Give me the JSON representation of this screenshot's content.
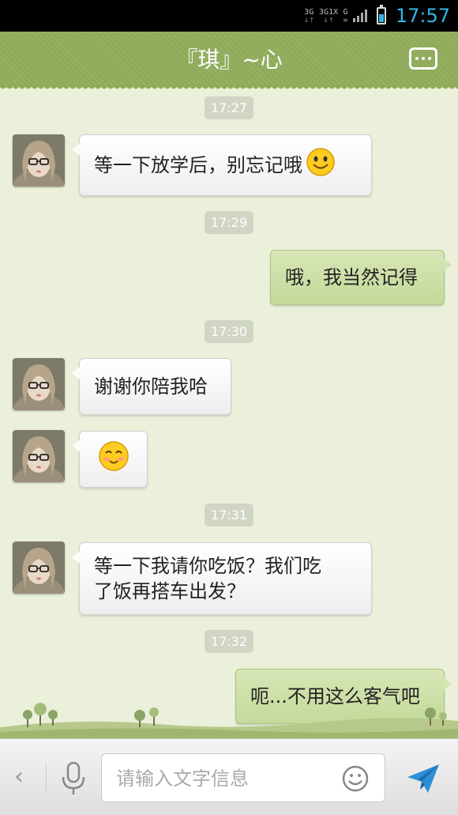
{
  "status_bar": {
    "network_labels": [
      "3G",
      "3G",
      "1X",
      "G"
    ],
    "time": "17:57",
    "battery_level": 0.55,
    "accent_color": "#33b5e5"
  },
  "header": {
    "title": "『琪』~心",
    "menu_icon": "more-dots-icon",
    "background_color": "#8fab5a"
  },
  "chat": {
    "timestamps": [
      "17:27",
      "17:29",
      "17:30",
      "17:31",
      "17:32"
    ],
    "messages": [
      {
        "direction": "incoming",
        "text": "等一下放学后，别忘记哦",
        "emoji": "smile-emoji"
      },
      {
        "direction": "outgoing",
        "text": "哦，我当然记得"
      },
      {
        "direction": "incoming",
        "text": "谢谢你陪我哈"
      },
      {
        "direction": "incoming",
        "text": "",
        "emoji": "blush-emoji"
      },
      {
        "direction": "incoming",
        "text_line1": "等一下我请你吃饭？我们吃",
        "text_line2": "了饭再搭车出发？"
      },
      {
        "direction": "outgoing",
        "text": "呃...不用这么客气吧"
      }
    ],
    "incoming_bubble_color": "#ffffff",
    "outgoing_bubble_color": "#cfe0a8"
  },
  "input_bar": {
    "placeholder": "请输入文字信息",
    "back_icon": "chevron-left-icon",
    "mic_icon": "microphone-icon",
    "emoji_icon": "smiley-icon",
    "send_icon": "send-icon"
  }
}
